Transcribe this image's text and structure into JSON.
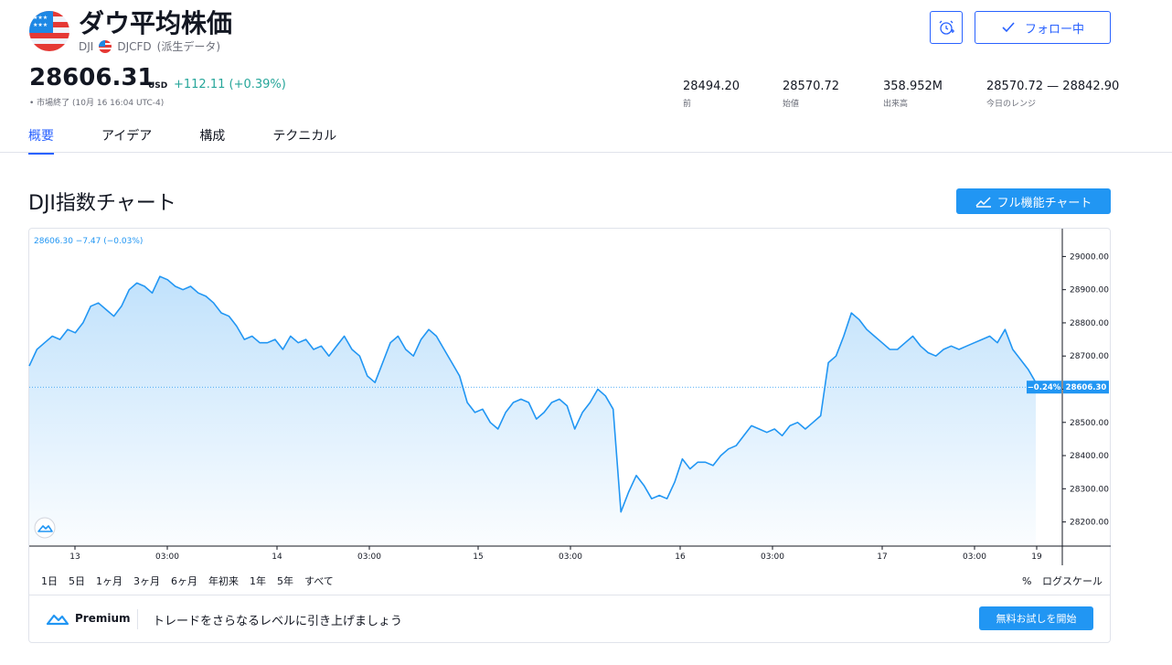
{
  "header": {
    "title": "ダウ平均株価",
    "symbol": "DJI",
    "alt_symbol": "DJCFD",
    "alt_note": "(派生データ)",
    "follow_label": "フォロー中"
  },
  "quote": {
    "price": "28606.31",
    "currency": "USD",
    "change": "+112.11 (+0.39%)",
    "market_status": "• 市場終了 (10月 16 16:04 UTC-4)"
  },
  "stats": [
    {
      "value": "28494.20",
      "label": "前"
    },
    {
      "value": "28570.72",
      "label": "始値"
    },
    {
      "value": "358.952M",
      "label": "出来高"
    },
    {
      "value": "28570.72 — 28842.90",
      "label": "今日のレンジ"
    }
  ],
  "tabs": [
    {
      "label": "概要",
      "active": true
    },
    {
      "label": "アイデア",
      "active": false
    },
    {
      "label": "構成",
      "active": false
    },
    {
      "label": "テクニカル",
      "active": false
    }
  ],
  "section": {
    "title": "DJI指数チャート",
    "full_chart_label": "フル機能チャート"
  },
  "colors": {
    "accent": "#2962ff",
    "line": "#2196f3",
    "positive": "#26a69a"
  },
  "chart_data": {
    "type": "area",
    "legend_text": "28606.30  −7.47 (−0.03%)",
    "y_ticks": [
      "29000.00",
      "28900.00",
      "28800.00",
      "28700.00",
      "28600.00",
      "28500.00",
      "28400.00",
      "28300.00",
      "28200.00"
    ],
    "ylim": [
      28130,
      29070
    ],
    "x_ticks": [
      "13",
      "03:00",
      "14",
      "03:00",
      "15",
      "03:00",
      "16",
      "03:00",
      "17",
      "03:00",
      "19"
    ],
    "last_value_label": "28606.30",
    "last_change_label": "−0.24%",
    "last_value": 28606.3,
    "grid": false,
    "series": [
      {
        "values": [
          28670,
          28720,
          28740,
          28760,
          28750,
          28780,
          28770,
          28800,
          28850,
          28860,
          28840,
          28820,
          28850,
          28900,
          28920,
          28910,
          28890,
          28940,
          28930,
          28910,
          28900,
          28910,
          28890,
          28880,
          28860,
          28830,
          28820,
          28790,
          28750,
          28760,
          28740,
          28740,
          28750,
          28720,
          28760,
          28740,
          28750,
          28720,
          28730,
          28700,
          28730,
          28760,
          28720,
          28700,
          28640,
          28620,
          28680,
          28740,
          28760,
          28720,
          28700,
          28750,
          28780,
          28760,
          28720,
          28680,
          28640,
          28560,
          28530,
          28540,
          28500,
          28480,
          28530,
          28560,
          28570,
          28560,
          28510,
          28530,
          28560,
          28570,
          28550,
          28480,
          28530,
          28560,
          28600,
          28580,
          28540,
          28230,
          28290,
          28340,
          28310,
          28270,
          28280,
          28270,
          28320,
          28390,
          28360,
          28380,
          28380,
          28370,
          28400,
          28420,
          28430,
          28460,
          28490,
          28480,
          28470,
          28480,
          28460,
          28490,
          28500,
          28480,
          28500,
          28520,
          28680,
          28700,
          28760,
          28830,
          28810,
          28780,
          28760,
          28740,
          28720,
          28720,
          28740,
          28760,
          28730,
          28710,
          28700,
          28720,
          28730,
          28720,
          28730,
          28740,
          28750,
          28760,
          28740,
          28780,
          28720,
          28690,
          28660,
          28620
        ]
      }
    ]
  },
  "ranges": [
    "1日",
    "5日",
    "1ヶ月",
    "3ヶ月",
    "6ヶ月",
    "年初来",
    "1年",
    "5年",
    "すべて"
  ],
  "scale": {
    "percent": "%",
    "log": "ログスケール"
  },
  "promo": {
    "brand": "Premium",
    "text": "トレードをさらなるレベルに引き上げましょう",
    "cta": "無料お試しを開始"
  }
}
